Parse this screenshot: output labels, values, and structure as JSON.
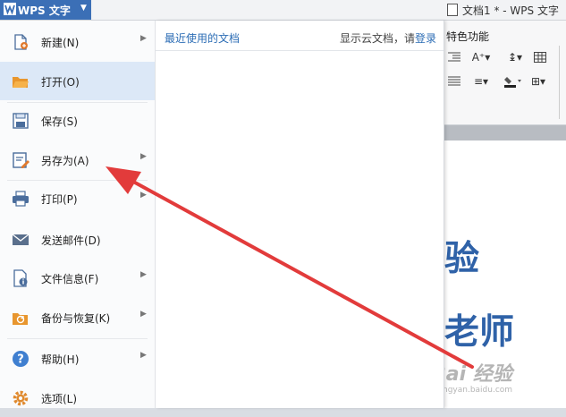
{
  "titlebar": {
    "app_name": "WPS 文字",
    "doc_title": "文档1 * - WPS 文字"
  },
  "ribbon": {
    "tab_label": "特色功能"
  },
  "menu": {
    "items": [
      {
        "label": "新建(N)",
        "icon": "new-document-icon",
        "has_submenu": true
      },
      {
        "label": "打开(O)",
        "icon": "folder-open-icon",
        "has_submenu": false
      },
      {
        "label": "保存(S)",
        "icon": "save-icon",
        "has_submenu": false
      },
      {
        "label": "另存为(A)",
        "icon": "save-as-icon",
        "has_submenu": true
      },
      {
        "label": "打印(P)",
        "icon": "printer-icon",
        "has_submenu": true
      },
      {
        "label": "发送邮件(D)",
        "icon": "mail-icon",
        "has_submenu": false
      },
      {
        "label": "文件信息(F)",
        "icon": "file-info-icon",
        "has_submenu": true
      },
      {
        "label": "备份与恢复(K)",
        "icon": "backup-icon",
        "has_submenu": true
      },
      {
        "label": "帮助(H)",
        "icon": "help-icon",
        "has_submenu": true
      },
      {
        "label": "选项(L)",
        "icon": "gear-icon",
        "has_submenu": false
      }
    ],
    "selected": "打开(O)"
  },
  "recent": {
    "title": "最近使用的文档",
    "cloud_prefix": "显示云文档，请",
    "login_link": "登录"
  },
  "document": {
    "heading_line1": "验",
    "heading_line2": "老师"
  },
  "watermark": {
    "main": "Bai 经验",
    "sub": "jingyan.baidu.com"
  },
  "colors": {
    "accent": "#3b6fb6",
    "link": "#2c6db5",
    "arrow": "#e23b3b",
    "selected_bg": "#dce8f7"
  }
}
